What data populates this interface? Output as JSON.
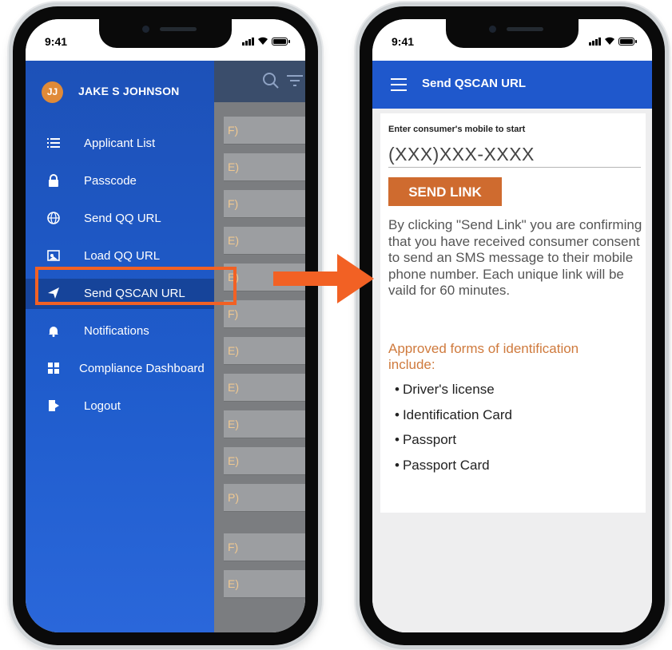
{
  "status_bar": {
    "time": "9:41"
  },
  "left_phone": {
    "drawer": {
      "avatar_initials": "JJ",
      "user_name": "JAKE S JOHNSON",
      "items": [
        {
          "label": "Applicant List",
          "icon": "list-icon"
        },
        {
          "label": "Passcode",
          "icon": "lock-icon"
        },
        {
          "label": "Send QQ URL",
          "icon": "globe-icon"
        },
        {
          "label": "Load QQ URL",
          "icon": "image-icon"
        },
        {
          "label": "Send QSCAN URL",
          "icon": "send-icon",
          "active": true
        },
        {
          "label": "Notifications",
          "icon": "bell-icon"
        },
        {
          "label": "Compliance Dashboard",
          "icon": "dashboard-icon"
        },
        {
          "label": "Logout",
          "icon": "logout-icon"
        }
      ]
    },
    "background_rows": [
      "F)",
      "E)",
      "F)",
      "E)",
      "E)",
      "F)",
      "E)",
      "E)",
      "E)",
      "E)",
      "P)",
      "F)",
      "E)"
    ]
  },
  "right_phone": {
    "header_title": "Send QSCAN URL",
    "mobile_label": "Enter consumer's mobile to start",
    "mobile_placeholder": "(XXX)XXX-XXXX",
    "send_button": "SEND LINK",
    "consent_text": "By clicking \"Send Link\" you are confirming that you have received consumer consent to send an SMS message to their mobile phone number. Each unique link will be vaild for 60 minutes.",
    "approved_heading": "Approved forms of identification include:",
    "id_forms": [
      "Driver's license",
      "Identification Card",
      "Passport",
      "Passport Card"
    ]
  },
  "colors": {
    "drawer_blue": "#1f5ccc",
    "header_blue": "#1f58cc",
    "accent_orange": "#f26124",
    "button_orange": "#cf6b2f"
  }
}
